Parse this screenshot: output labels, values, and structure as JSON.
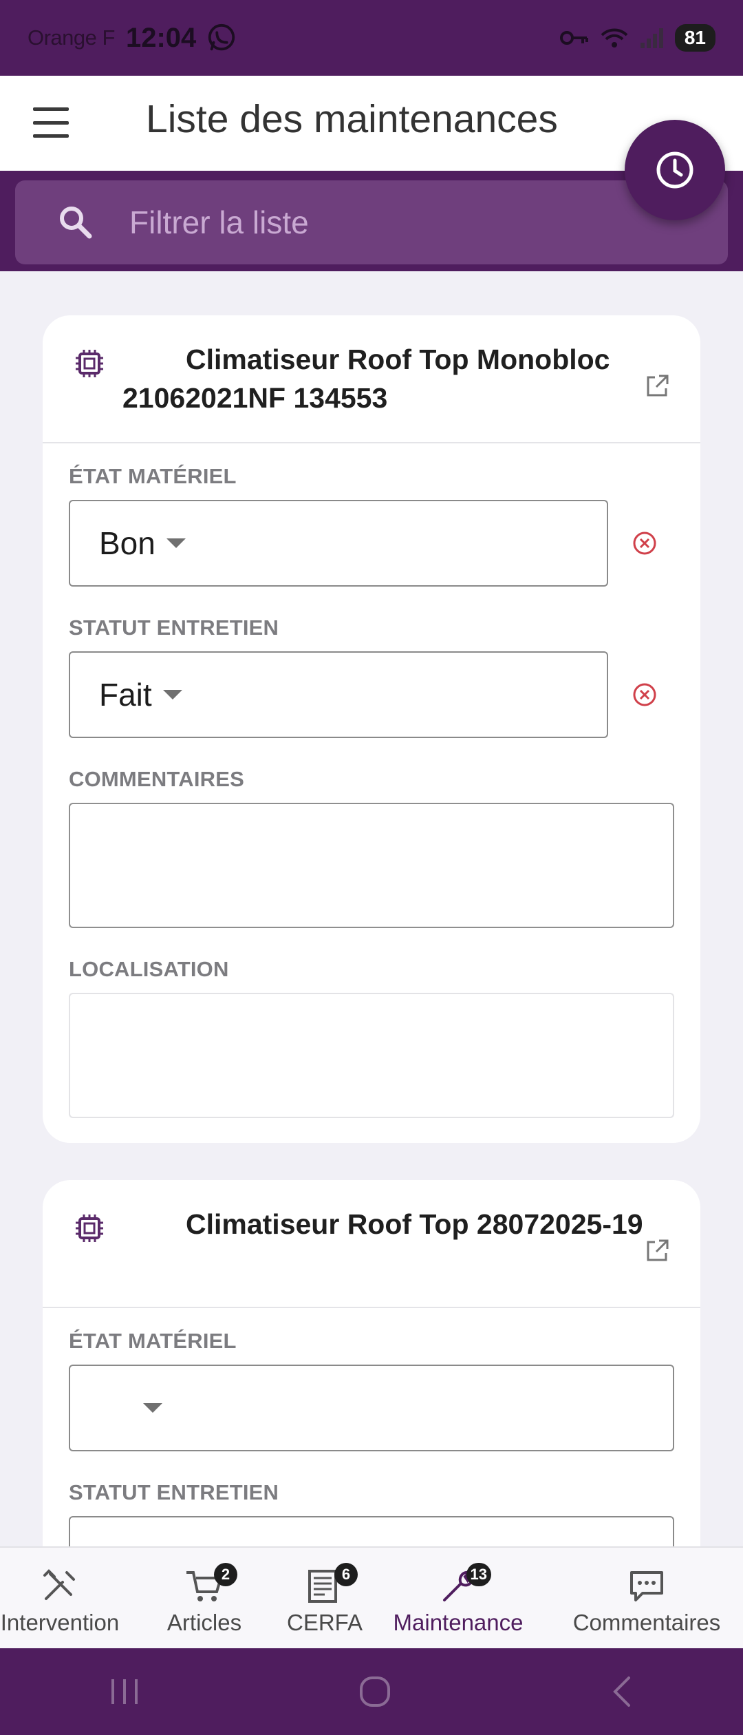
{
  "status_bar": {
    "carrier": "Orange F",
    "time": "12:04",
    "battery": "81"
  },
  "app_bar": {
    "title": "Liste des maintenances"
  },
  "search": {
    "placeholder": "Filtrer la liste"
  },
  "cards": [
    {
      "title": "Climatiseur Roof Top Monobloc 21062021NF 134553",
      "etat_label": "ÉTAT MATÉRIEL",
      "etat_value": "Bon",
      "statut_label": "STATUT ENTRETIEN",
      "statut_value": "Fait",
      "commentaires_label": "COMMENTAIRES",
      "commentaires_value": "",
      "localisation_label": "LOCALISATION",
      "localisation_value": ""
    },
    {
      "title": "Climatiseur Roof Top 28072025-19",
      "etat_label": "ÉTAT MATÉRIEL",
      "etat_value": "",
      "statut_label": "STATUT ENTRETIEN",
      "statut_value": ""
    }
  ],
  "bottom_nav": [
    {
      "label": "Intervention",
      "icon": "tools-icon",
      "badge": ""
    },
    {
      "label": "Articles",
      "icon": "cart-icon",
      "badge": "2"
    },
    {
      "label": "CERFA",
      "icon": "document-icon",
      "badge": "6"
    },
    {
      "label": "Maintenance",
      "icon": "wrench-icon",
      "badge": "13",
      "active": true
    },
    {
      "label": "Commentaires",
      "icon": "chat-icon",
      "badge": ""
    }
  ],
  "colors": {
    "primary": "#4f1d5e",
    "search_bg": "#6f3f7d",
    "clear_red": "#d0404a"
  }
}
